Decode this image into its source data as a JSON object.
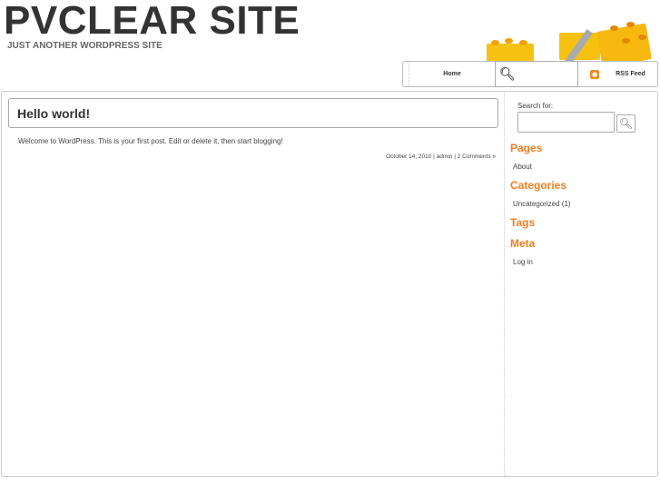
{
  "site": {
    "title": "PVCLEAR SITE",
    "tagline": "JUST ANOTHER WORDPRESS SITE"
  },
  "nav": {
    "home": "Home",
    "rss": "RSS Feed"
  },
  "post": {
    "title": "Hello world!",
    "body": "Welcome to WordPress. This is your first post. Edit or delete it, then start blogging!",
    "date": "October 14, 2010",
    "author": "admin",
    "comments": "2 Comments »",
    "sep": "|"
  },
  "sidebar": {
    "search_label": "Search for:",
    "pages_title": "Pages",
    "pages": [
      "About"
    ],
    "categories_title": "Categories",
    "categories": [
      "Uncategorized (1)"
    ],
    "tags_title": "Tags",
    "meta_title": "Meta",
    "meta": [
      "Log in"
    ]
  }
}
